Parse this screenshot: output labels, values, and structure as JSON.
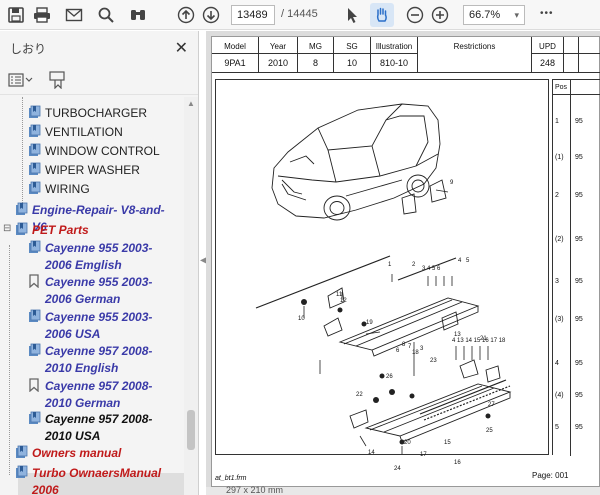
{
  "toolbar": {
    "page_current": "13489",
    "page_total": "/ 14445",
    "zoom": "66.7%",
    "zoom_arrow": "▾",
    "more": "•••"
  },
  "sidebar": {
    "title": "しおり",
    "close": "✕",
    "items": [
      {
        "label": "TURBOCHARGER",
        "style": "norm"
      },
      {
        "label": "VENTILATION",
        "style": "norm"
      },
      {
        "label": "WINDOW CONTROL",
        "style": "norm"
      },
      {
        "label": "WIPER WASHER",
        "style": "norm"
      },
      {
        "label": "WIRING",
        "style": "norm"
      },
      {
        "label": "Engine-Repair- V8-and-V6",
        "style": "blue"
      },
      {
        "label": "PET Parts",
        "style": "red"
      },
      {
        "label": "Cayenne 955 2003-2006 Emglish",
        "style": "blue"
      },
      {
        "label": "Cayenne 955 2003-2006 German",
        "style": "blue"
      },
      {
        "label": "Cayenne 955 2003-2006 USA",
        "style": "blue"
      },
      {
        "label": "Cayenne 957 2008-2010 English",
        "style": "blue"
      },
      {
        "label": "Cayenne 957 2008-2010 German",
        "style": "blue"
      },
      {
        "label": "Cayenne 957 2008-2010 USA",
        "style": "black"
      },
      {
        "label": "Owners manual",
        "style": "red"
      },
      {
        "label": "Turbo OwnaersManual 2006",
        "style": "red"
      }
    ],
    "expander_minus": "⊟"
  },
  "header": {
    "model_label": "Model",
    "model_value": "9PA1",
    "year_label": "Year",
    "year_value": "2010",
    "mg_label": "MG",
    "mg_value": "8",
    "sg_label": "SG",
    "sg_value": "10",
    "illustration_label": "Illustration",
    "illustration_value": "810-10",
    "restrictions_label": "Restrictions",
    "upd_label": "UPD",
    "upd_value": "248"
  },
  "right_column": {
    "header": "Pos",
    "rows": [
      "1",
      "(1)",
      "2",
      "(2)",
      "3",
      "(3)",
      "4",
      "(4)",
      "5"
    ],
    "prefix": "95"
  },
  "diagram": {
    "labels": [
      "9",
      "1",
      "2",
      "3",
      "4",
      "5",
      "6",
      "7",
      "8",
      "10",
      "11",
      "12",
      "13",
      "14",
      "15",
      "16",
      "17",
      "18",
      "19",
      "20",
      "21",
      "22",
      "23",
      "24",
      "25",
      "26",
      "27"
    ],
    "range_a": "3 4 5 6",
    "range_b": "4 13 14 15 16 17 18"
  },
  "footer": {
    "file": "at_bt1.frm",
    "page": "Page: 001"
  },
  "status": {
    "size": "297 x 210 mm"
  }
}
